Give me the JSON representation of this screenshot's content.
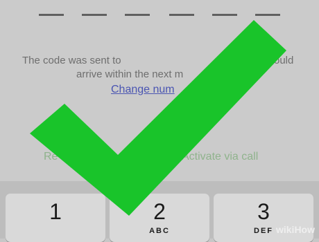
{
  "message": {
    "line1_start": "The code was sent to",
    "line1_end": "ould",
    "line2": "arrive within the next m"
  },
  "change_number": "Change num",
  "resend_label": "Re",
  "activate_call": "Activate via call",
  "keys": [
    {
      "num": "1",
      "letters": ""
    },
    {
      "num": "2",
      "letters": "ABC"
    },
    {
      "num": "3",
      "letters": "DEF"
    }
  ],
  "overlay_icon": "checkmark-icon",
  "colors": {
    "checkmark": "#19c42a",
    "link": "#4a55b2"
  },
  "watermark": "wikiHow"
}
